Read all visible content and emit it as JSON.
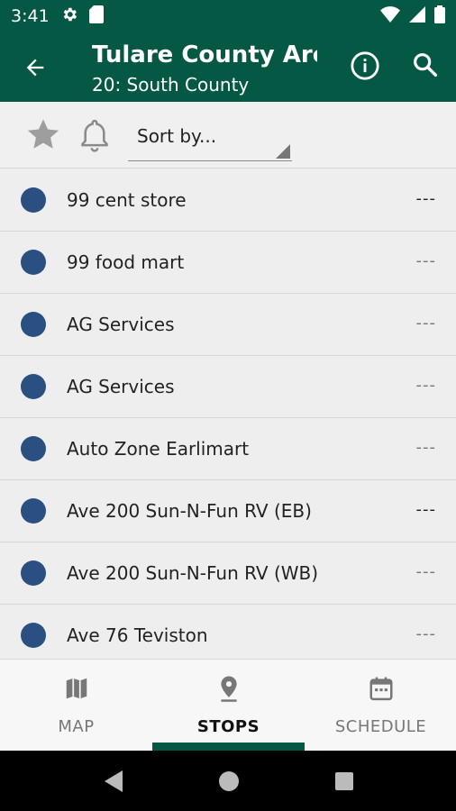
{
  "status_bar": {
    "time": "3:41",
    "left_icons": [
      "gear-icon",
      "sd-card-icon"
    ],
    "right_icons": [
      "wifi-icon",
      "signal-icon",
      "battery-icon"
    ]
  },
  "app_bar": {
    "title": "Tulare County Are...",
    "subtitle": "20: South County",
    "background_color": "#055844"
  },
  "filter_bar": {
    "sort_label": "Sort by..."
  },
  "stops": [
    {
      "name": "99 cent store",
      "time": "---"
    },
    {
      "name": "99 food mart",
      "time": "---"
    },
    {
      "name": "AG Services",
      "time": "---"
    },
    {
      "name": "AG Services",
      "time": "---"
    },
    {
      "name": "Auto Zone Earlimart",
      "time": "---"
    },
    {
      "name": "Ave 200 Sun-N-Fun RV (EB)",
      "time": "---"
    },
    {
      "name": "Ave 200 Sun-N-Fun RV (WB)",
      "time": "---"
    },
    {
      "name": "Ave 76 Teviston",
      "time": "---"
    }
  ],
  "stop_dot_color": "#2a5082",
  "bottom_nav": {
    "items": [
      {
        "label": "MAP",
        "icon": "map-icon",
        "active": false
      },
      {
        "label": "STOPS",
        "icon": "location-pin-icon",
        "active": true
      },
      {
        "label": "SCHEDULE",
        "icon": "calendar-icon",
        "active": false
      }
    ]
  }
}
